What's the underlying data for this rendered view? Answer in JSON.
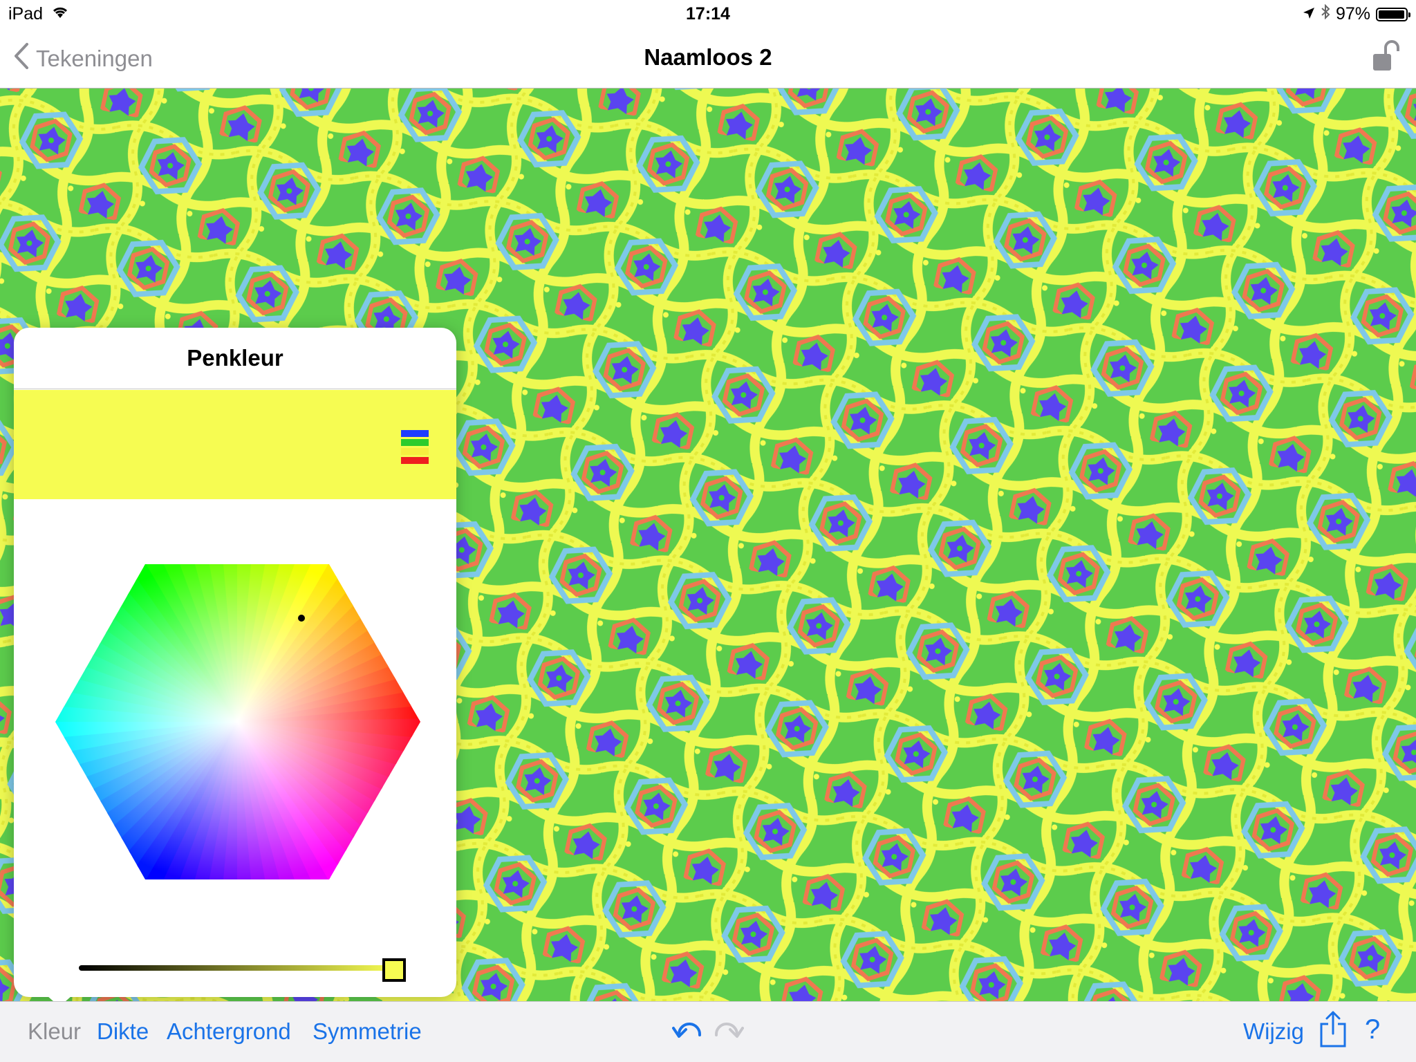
{
  "status": {
    "device": "iPad",
    "time": "17:14",
    "battery": "97%",
    "battery_level": 0.97,
    "icons": [
      "wifi-icon",
      "location-icon",
      "bluetooth-icon",
      "battery-icon"
    ]
  },
  "nav": {
    "back_label": "Tekeningen",
    "title": "Naamloos 2",
    "lock_icon": "unlocked-padlock-icon"
  },
  "popover": {
    "title": "Penkleur",
    "selected_color": "#f6fc52",
    "palette_icon": "color-palette-icon",
    "palette_stripes": [
      "#1c3cff",
      "#2ccc2c",
      "#f6f040",
      "#ee1f1f"
    ],
    "color_picker": {
      "type": "hexagon",
      "marker_color": "#000000"
    },
    "brightness": 1.0
  },
  "toolbar": {
    "items": [
      {
        "label": "Kleur",
        "selected": true
      },
      {
        "label": "Dikte",
        "selected": false
      },
      {
        "label": "Achtergrond",
        "selected": false
      },
      {
        "label": "Symmetrie",
        "selected": false
      }
    ],
    "undo_icon": "undo-arrow-icon",
    "redo_icon": "redo-arrow-icon",
    "edit_label": "Wijzig",
    "share_icon": "share-icon",
    "help_label": "?"
  },
  "colors": {
    "accent": "#1a73e8",
    "canvas_background": "#5ccc4c",
    "pen_yellow": "#f6fc52",
    "light_blue": "#7ec8e8",
    "coral": "#f07850",
    "violet": "#5a44f0",
    "disabled": "#8e8e93"
  }
}
